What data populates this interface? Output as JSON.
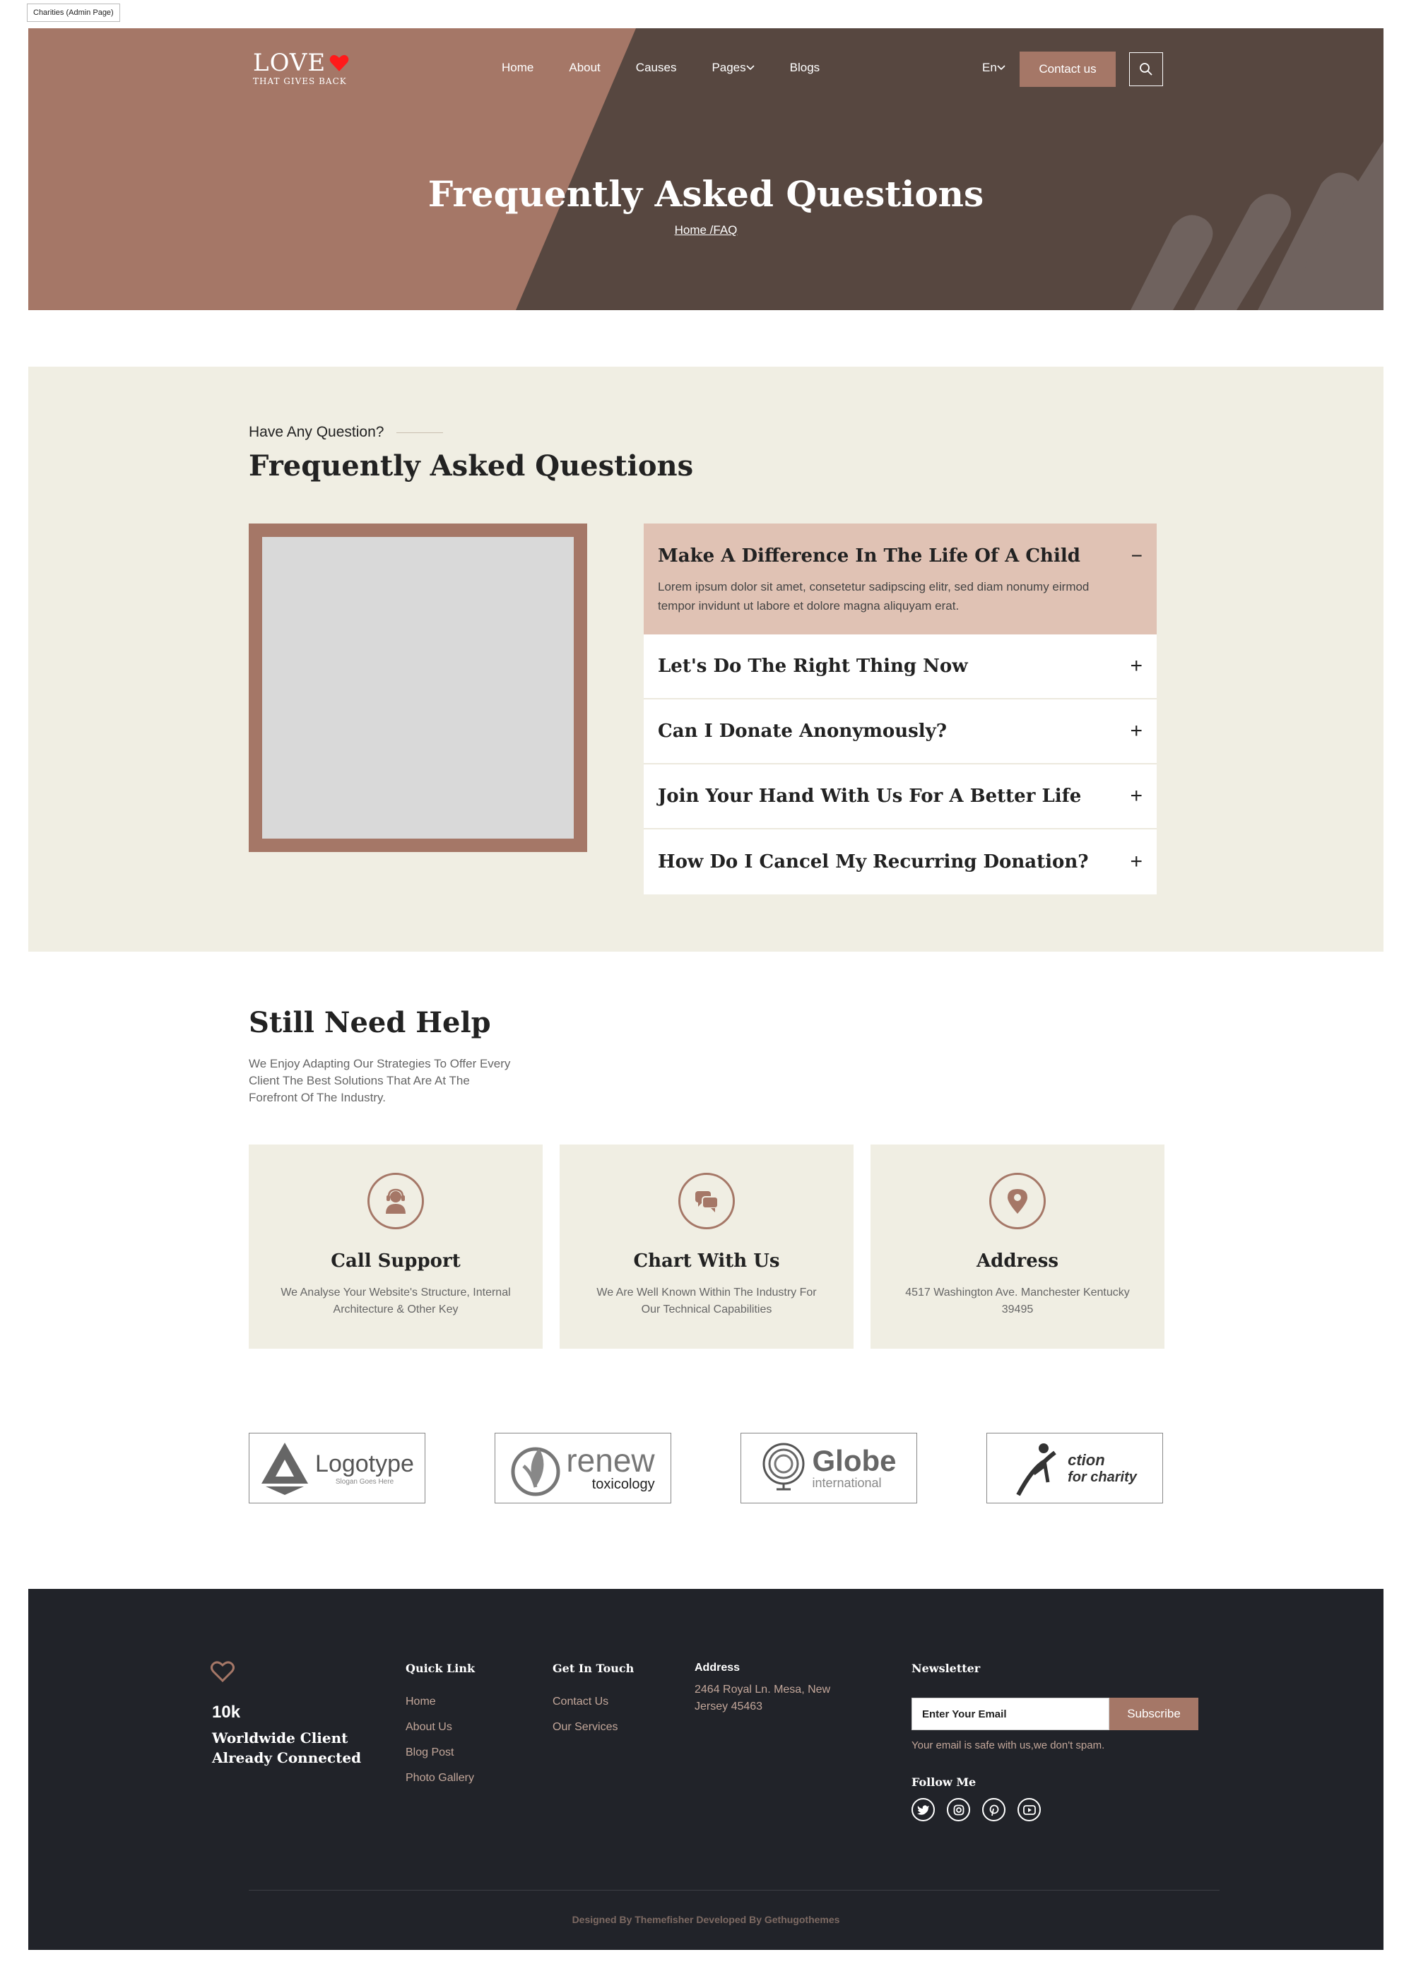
{
  "page_tag": "Charities (Admin Page)",
  "header": {
    "logo_main": "LOVE",
    "logo_sub": "THAT GIVES BACK",
    "nav": [
      "Home",
      "About",
      "Causes",
      "Pages",
      "Blogs"
    ],
    "lang": "En",
    "contact_label": "Contact us"
  },
  "hero": {
    "title": "Frequently Asked Questions",
    "breadcrumb": "Home /FAQ"
  },
  "faq": {
    "eyebrow": "Have Any Question?",
    "title": "Frequently Asked Questions",
    "open_question": "Make A Difference In The Life Of A Child",
    "open_answer": "Lorem ipsum dolor sit amet, consetetur sadipscing elitr, sed diam nonumy eirmod tempor invidunt ut labore et dolore magna aliquyam erat.",
    "open_sign": "−",
    "items": [
      {
        "q": "Let's Do The Right Thing Now",
        "sign": "+"
      },
      {
        "q": "Can I Donate Anonymously?",
        "sign": "+"
      },
      {
        "q": "Join Your Hand With Us For A Better Life",
        "sign": "+"
      },
      {
        "q": "How Do I Cancel My Recurring Donation?",
        "sign": "+"
      }
    ]
  },
  "help": {
    "title": "Still Need Help",
    "text": "We Enjoy Adapting Our Strategies To Offer Every Client The Best Solutions That Are At The Forefront Of The Industry.",
    "cards": [
      {
        "title": "Call Support",
        "desc": "We Analyse Your Website's Structure, Internal Architecture & Other Key",
        "icon": "support-agent-icon"
      },
      {
        "title": "Chart With Us",
        "desc": "We Are Well Known Within The Industry For Our Technical Capabilities",
        "icon": "chat-bubbles-icon"
      },
      {
        "title": "Address",
        "desc": "4517 Washington Ave. Manchester Kentucky 39495",
        "icon": "map-pin-icon"
      }
    ]
  },
  "brands": {
    "logotype": {
      "name": "Logotype",
      "slogan": "Slogan Goes Here"
    },
    "renew": {
      "name": "renew",
      "sub": "toxicology"
    },
    "globe": {
      "name": "Globe",
      "sub": "international"
    },
    "action": {
      "name": "ction",
      "sub": "for charity"
    }
  },
  "footer": {
    "stat_num": "10k",
    "stat_text": "Worldwide Client Already Connected",
    "quick_link_head": "Quick Link",
    "quick_links": [
      "Home",
      "About Us",
      "Blog Post",
      "Photo Gallery"
    ],
    "touch_head": "Get In Touch",
    "touch_links": [
      "Contact Us",
      "Our Services"
    ],
    "address_head": "Address",
    "address": "2464 Royal Ln. Mesa, New Jersey 45463",
    "newsletter_head": "Newsletter",
    "email_placeholder": "Enter Your Email",
    "subscribe": "Subscribe",
    "spam_note": "Your email is safe with us,we don't spam.",
    "follow_head": "Follow Me",
    "social": [
      "twitter-icon",
      "instagram-icon",
      "pinterest-icon",
      "youtube-icon"
    ],
    "credit": "Designed By Themefisher Developed By Gethugothemes"
  },
  "colors": {
    "accent": "#a57767",
    "dark_brown": "#574740",
    "cream": "#f0eee3",
    "faq_open": "#e0c2b4",
    "footer": "#212329",
    "heart": "#ff1a1a"
  }
}
